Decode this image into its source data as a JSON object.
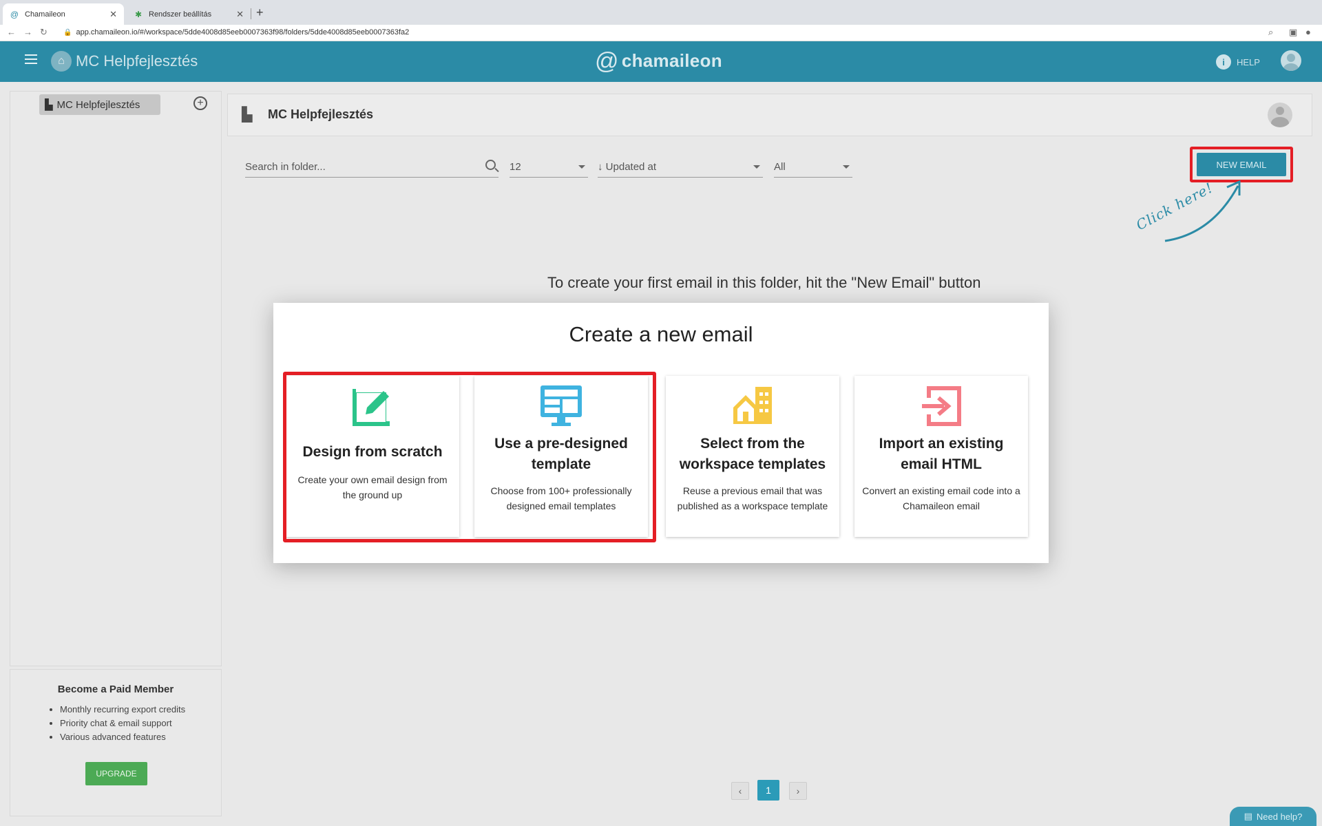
{
  "browser": {
    "tabs": [
      {
        "title": "Chamaileon",
        "favicon": "at-icon",
        "active": true
      },
      {
        "title": "Rendszer beállítás",
        "favicon": "colorful-logo-icon",
        "active": false
      }
    ],
    "new_tab": "+",
    "url": "app.chamaileon.io/#/workspace/5dde4008d85eeb0007363f98/folders/5dde4008d85eeb0007363fa2"
  },
  "header": {
    "workspace_name": "MC Helpfejlesztés",
    "logo_text": "chamaileon",
    "logo_symbol": "@",
    "help_label": "HELP",
    "brand_color": "#2b8ba6"
  },
  "sidebar": {
    "workspace_item": "MC Helpfejlesztés",
    "paid": {
      "title": "Become a Paid Member",
      "features": [
        "Monthly recurring export credits",
        "Priority chat & email support",
        "Various advanced features"
      ],
      "upgrade_label": "UPGRADE"
    }
  },
  "main": {
    "folder_title": "MC Helpfejlesztés",
    "search_placeholder": "Search in folder...",
    "per_page": "12",
    "sort": "Updated at",
    "filter": "All",
    "new_email_label": "NEW EMAIL",
    "annotation": "Click here!",
    "empty_message": "To create your first email in this folder, hit the \"New Email\" button"
  },
  "modal": {
    "title": "Create a new email",
    "cards": [
      {
        "title": "Design from scratch",
        "desc": "Create your own email design from the ground up",
        "icon": "edit-icon",
        "color": "#2bc48a"
      },
      {
        "title": "Use a pre-designed template",
        "desc": "Choose from 100+ professionally designed email templates",
        "icon": "monitor-template-icon",
        "color": "#3fb3e0"
      },
      {
        "title": "Select from the workspace templates",
        "desc": "Reuse a previous email that was published as a workspace template",
        "icon": "buildings-icon",
        "color": "#f6c843"
      },
      {
        "title": "Import an existing email HTML",
        "desc": "Convert an existing email code into a Chamaileon email",
        "icon": "import-icon",
        "color": "#f47c86"
      }
    ]
  },
  "pagination": {
    "current": "1",
    "prev": "‹",
    "next": "›"
  },
  "chat": {
    "label": "Need help?"
  },
  "highlight_color": "#e41e25"
}
